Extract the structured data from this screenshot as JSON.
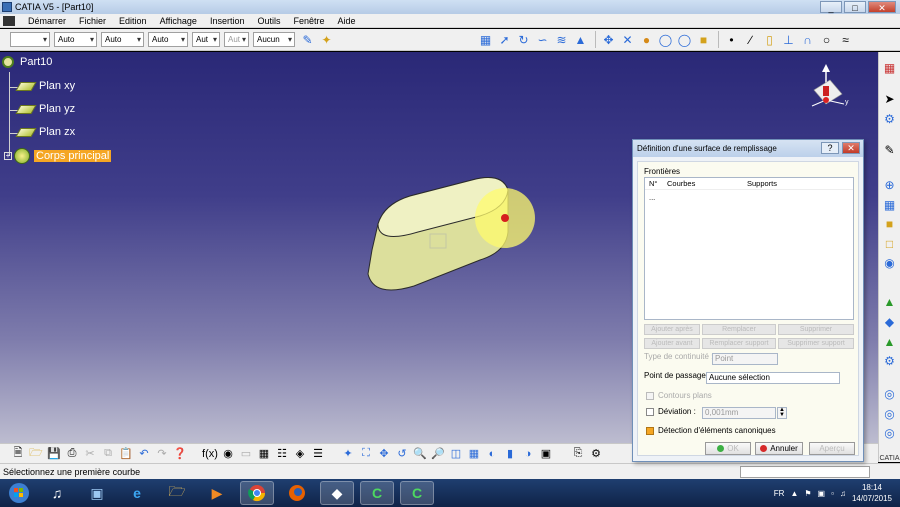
{
  "window": {
    "title": "CATIA V5 - [Part10]",
    "min": "_",
    "max": "□",
    "close": "✕"
  },
  "menu": [
    "Démarrer",
    "Fichier",
    "Edition",
    "Affichage",
    "Insertion",
    "Outils",
    "Fenêtre",
    "Aide"
  ],
  "toolbar": {
    "combos": [
      "Auto",
      "Auto",
      "Auto",
      "Aut",
      "Aut",
      "Aucun"
    ]
  },
  "tree": {
    "root": "Part10",
    "planes": [
      "Plan xy",
      "Plan yz",
      "Plan zx"
    ],
    "body": "Corps principal"
  },
  "dialog": {
    "title": "Définition d'une surface de remplissage",
    "help": "?",
    "close": "✕",
    "group": "Frontières",
    "columns": [
      "N°",
      "Courbes",
      "Supports"
    ],
    "row": "...",
    "buttons": [
      "Ajouter après",
      "Remplacer",
      "Supprimer",
      "Ajouter avant",
      "Remplacer support",
      "Supprimer support"
    ],
    "continuity_label": "Type de continuité :",
    "continuity_value": "Point",
    "passage_label": "Point de passage",
    "passage_value": "Aucune sélection",
    "contour_label": "Contours plans",
    "deviation_label": "Déviation :",
    "deviation_value": "0,001mm",
    "detection_label": "Détection d'éléments canoniques",
    "ok": "OK",
    "cancel": "Annuler",
    "preview": "Aperçu"
  },
  "status": {
    "text": "Sélectionnez une première courbe"
  },
  "taskbar": {
    "lang": "FR",
    "time": "18:14",
    "date": "14/07/2015"
  },
  "brand": "CATIA"
}
